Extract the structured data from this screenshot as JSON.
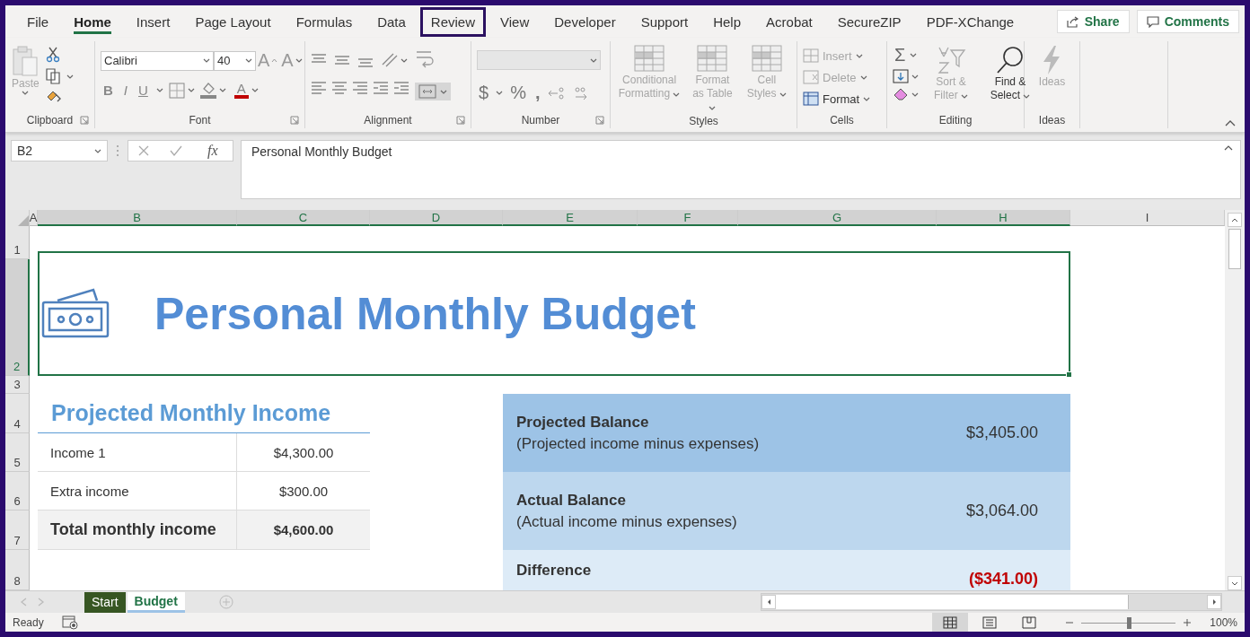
{
  "ribbon_tabs": [
    {
      "label": "File",
      "selected": false,
      "highlighted": false
    },
    {
      "label": "Home",
      "selected": true,
      "highlighted": false
    },
    {
      "label": "Insert",
      "selected": false,
      "highlighted": false
    },
    {
      "label": "Page Layout",
      "selected": false,
      "highlighted": false
    },
    {
      "label": "Formulas",
      "selected": false,
      "highlighted": false
    },
    {
      "label": "Data",
      "selected": false,
      "highlighted": false
    },
    {
      "label": "Review",
      "selected": false,
      "highlighted": true
    },
    {
      "label": "View",
      "selected": false,
      "highlighted": false
    },
    {
      "label": "Developer",
      "selected": false,
      "highlighted": false
    },
    {
      "label": "Support",
      "selected": false,
      "highlighted": false
    },
    {
      "label": "Help",
      "selected": false,
      "highlighted": false
    },
    {
      "label": "Acrobat",
      "selected": false,
      "highlighted": false
    },
    {
      "label": "SecureZIP",
      "selected": false,
      "highlighted": false
    },
    {
      "label": "PDF-XChange",
      "selected": false,
      "highlighted": false
    }
  ],
  "ribbon_actions": [
    "Share",
    "Comments"
  ],
  "ribbon": {
    "clipboard": {
      "label": "Clipboard",
      "paste": {
        "label": "Paste",
        "disabled": true
      }
    },
    "font": {
      "label": "Font",
      "font_name": "Calibri",
      "font_size": "40",
      "grow": "A",
      "shrink": "A",
      "bold": "B",
      "italic": "I",
      "underline": "U",
      "font_color": "A"
    },
    "alignment": {
      "label": "Alignment"
    },
    "number": {
      "label": "Number",
      "currency": "$",
      "percent": "%",
      "comma": ","
    },
    "styles": {
      "label": "Styles",
      "buttons": [
        {
          "label": "Conditional Formatting",
          "disabled": true
        },
        {
          "label": "Format as Table",
          "disabled": true
        },
        {
          "label": "Cell Styles",
          "disabled": true
        }
      ]
    },
    "cells": {
      "label": "Cells",
      "buttons": [
        {
          "label": "Insert",
          "disabled": true
        },
        {
          "label": "Delete",
          "disabled": true
        },
        {
          "label": "Format",
          "disabled": false
        }
      ]
    },
    "editing": {
      "label": "Editing",
      "autosum": "Σ",
      "buttons": [
        {
          "label": "Sort & Filter",
          "disabled": true
        },
        {
          "label": "Find & Select",
          "disabled": false
        }
      ]
    },
    "ideas": {
      "label": "Ideas",
      "button": {
        "label": "Ideas",
        "disabled": true
      }
    }
  },
  "formula_bar": {
    "name_box": "B2",
    "function_label": "fx",
    "formula": "Personal Monthly Budget"
  },
  "columns": [
    {
      "label": "A",
      "selected": false
    },
    {
      "label": "B",
      "selected": true
    },
    {
      "label": "C",
      "selected": true
    },
    {
      "label": "D",
      "selected": true
    },
    {
      "label": "E",
      "selected": true
    },
    {
      "label": "F",
      "selected": true
    },
    {
      "label": "G",
      "selected": true
    },
    {
      "label": "H",
      "selected": true
    },
    {
      "label": "I",
      "selected": false
    }
  ],
  "rows": [
    {
      "label": "1",
      "selected": false
    },
    {
      "label": "2",
      "selected": true
    },
    {
      "label": "3",
      "selected": false
    },
    {
      "label": "4",
      "selected": false
    },
    {
      "label": "5",
      "selected": false
    },
    {
      "label": "6",
      "selected": false
    },
    {
      "label": "7",
      "selected": false
    },
    {
      "label": "8",
      "selected": false
    }
  ],
  "sheet": {
    "title": "Personal Monthly Budget",
    "income": {
      "heading": "Projected Monthly Income",
      "rows": [
        {
          "label": "Income 1",
          "amount": "$4,300.00",
          "kind": "item"
        },
        {
          "label": "Extra income",
          "amount": "$300.00",
          "kind": "item"
        },
        {
          "label": "Total monthly income",
          "amount": "$4,600.00",
          "kind": "total"
        }
      ]
    },
    "balances": [
      {
        "title": "Projected Balance",
        "note": "(Projected income minus expenses)",
        "amount": "$3,405.00",
        "negative": false,
        "color": "#9dc3e6"
      },
      {
        "title": "Actual Balance",
        "note": "(Actual income minus expenses)",
        "amount": "$3,064.00",
        "negative": false,
        "color": "#bdd7ee"
      },
      {
        "title": "Difference",
        "amount": "($341.00)",
        "negative": true,
        "color": "#ddebf7"
      }
    ]
  },
  "sheet_tabs": [
    {
      "label": "Start",
      "selected": false,
      "color": "#375623"
    },
    {
      "label": "Budget",
      "selected": true,
      "color": "#9dc3e6"
    }
  ],
  "status_bar": {
    "status": "Ready",
    "views": [
      {
        "kind": "normal",
        "selected": true
      },
      {
        "kind": "page_layout",
        "selected": false
      },
      {
        "kind": "page_break",
        "selected": false
      }
    ],
    "level": 0.5,
    "zoom": "100%"
  }
}
